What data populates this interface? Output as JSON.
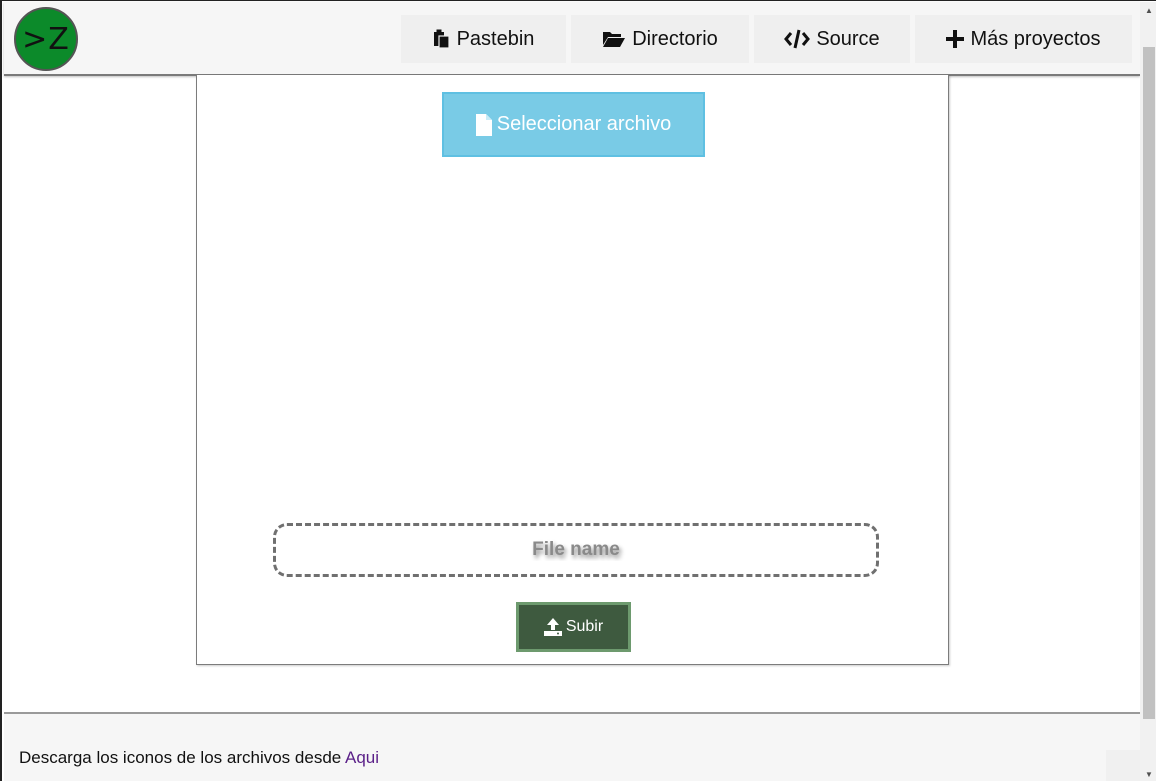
{
  "header": {
    "logo_text": ">Z",
    "logo_color": "#0c8a2a",
    "nav": [
      {
        "label": "Pastebin",
        "icon": "clipboard-icon"
      },
      {
        "label": "Directorio",
        "icon": "folder-open-icon"
      },
      {
        "label": "Source",
        "icon": "code-icon"
      },
      {
        "label": "Más proyectos",
        "icon": "plus-icon"
      }
    ]
  },
  "upload": {
    "select_label": "Seleccionar archivo",
    "select_icon": "file-icon",
    "select_color": "#79cbe6",
    "filename_placeholder": "File name",
    "submit_label": "Subir",
    "submit_icon": "upload-icon",
    "submit_color": "#3e5a3f"
  },
  "footer": {
    "text": "Descarga los iconos de los archivos desde ",
    "link_label": "Aqui",
    "link_color": "#5a1f88"
  }
}
